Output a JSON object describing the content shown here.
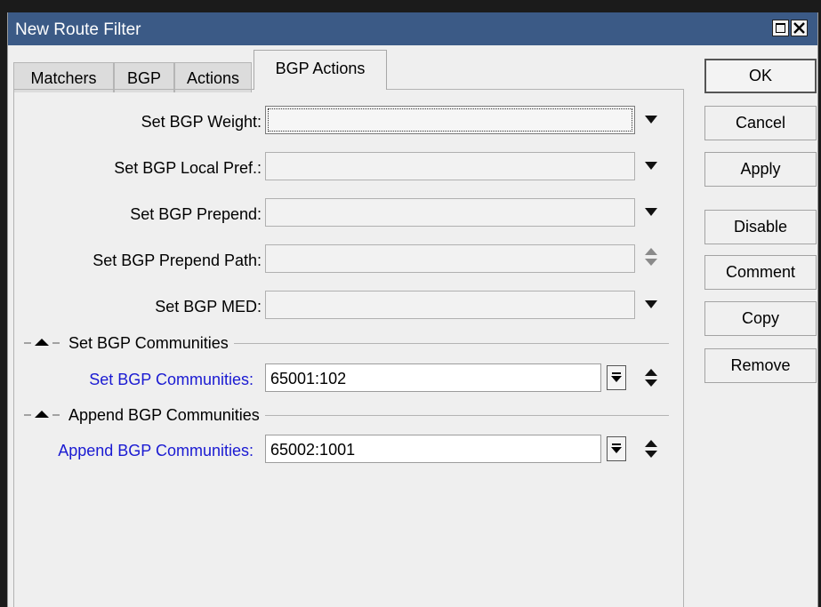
{
  "window": {
    "title": "New Route Filter"
  },
  "tabs": [
    {
      "label": "Matchers"
    },
    {
      "label": "BGP"
    },
    {
      "label": "Actions"
    },
    {
      "label": "BGP Actions",
      "active": true
    }
  ],
  "fields": [
    {
      "label": "Set BGP Weight:",
      "value": ""
    },
    {
      "label": "Set BGP Local Pref.:",
      "value": ""
    },
    {
      "label": "Set BGP Prepend:",
      "value": ""
    },
    {
      "label": "Set BGP Prepend Path:",
      "value": ""
    },
    {
      "label": "Set BGP MED:",
      "value": ""
    }
  ],
  "sections": [
    {
      "title": "Set BGP Communities",
      "field_label": "Set BGP Communities:",
      "value": "65001:102"
    },
    {
      "title": "Append BGP Communities",
      "field_label": "Append BGP Communities:",
      "value": "65002:1001"
    }
  ],
  "buttons": {
    "ok": "OK",
    "cancel": "Cancel",
    "apply": "Apply",
    "disable": "Disable",
    "comment": "Comment",
    "copy": "Copy",
    "remove": "Remove"
  },
  "colors": {
    "titlebar": "#3b5a86",
    "link_label": "#1a1ad2",
    "dialog_bg": "#efefef"
  },
  "icons": [
    "maximize-icon",
    "close-icon",
    "dropdown-arrow-icon",
    "up-down-arrows-icon",
    "collapse-triangle-icon",
    "list-down-icon"
  ]
}
